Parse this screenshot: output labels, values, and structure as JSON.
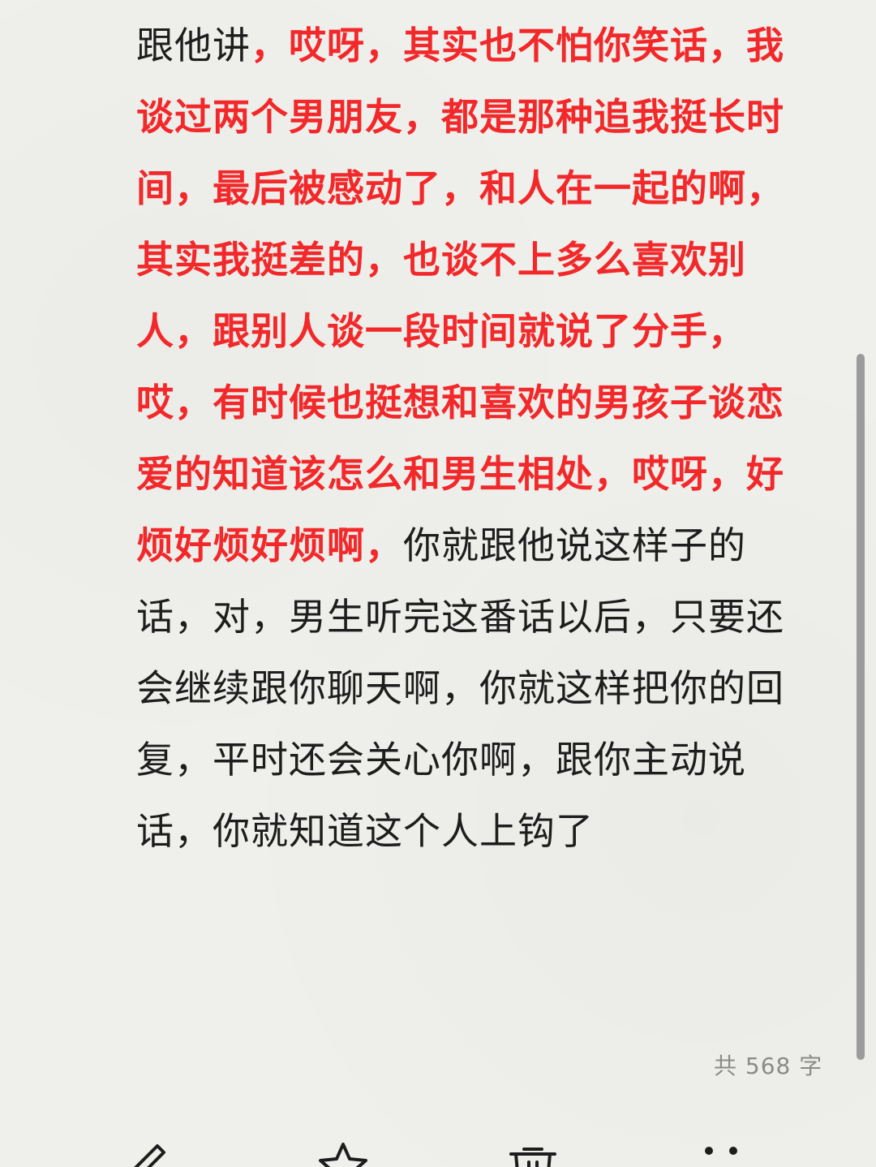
{
  "note": {
    "segments": [
      {
        "text": "跟他讲",
        "highlight": false
      },
      {
        "text": "，哎呀，其实也不怕你笑话，我谈过两个男朋友，都是那种追我挺长时间，最后被感动了，和人在一起的啊，其实我挺差的，也谈不上多么喜欢别人，跟别人谈一段时间就说了分手，哎，有时候也挺想和喜欢的男孩子谈恋爱的知道该怎么和男生相处，哎呀，好烦好烦好烦啊，",
        "highlight": true
      },
      {
        "text": "你就跟他说这样子的话，对，男生听完这番话以后，只要还会继续跟你聊天啊，你就这样把你的回复，平时还会关心你啊，跟你主动说话，你就知道这个人上钩了",
        "highlight": false
      }
    ],
    "word_count": "共 568 字"
  },
  "colors": {
    "background": "#efefeb",
    "text": "#1d1d1d",
    "highlight": "#f2282a",
    "muted": "#8a8a8a",
    "scrollbar": "#9b9b9b"
  },
  "toolbar": {
    "icons": [
      "edit-icon",
      "star-icon",
      "delete-icon",
      "more-icon"
    ]
  }
}
